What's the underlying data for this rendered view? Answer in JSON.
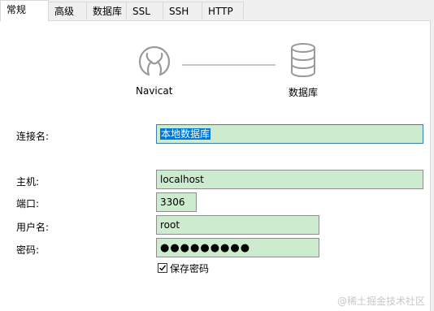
{
  "tabs": [
    {
      "label": "常规",
      "active": true
    },
    {
      "label": "高级"
    },
    {
      "label": "数据库"
    },
    {
      "label": "SSL"
    },
    {
      "label": "SSH"
    },
    {
      "label": "HTTP"
    }
  ],
  "diagram": {
    "left_label": "Navicat",
    "right_label": "数据库",
    "left_icon": "navicat-logo-icon",
    "right_icon": "database-icon"
  },
  "form": {
    "connection_name": {
      "label": "连接名:",
      "value": "本地数据库"
    },
    "host": {
      "label": "主机:",
      "value": "localhost"
    },
    "port": {
      "label": "端口:",
      "value": "3306"
    },
    "username": {
      "label": "用户名:",
      "value": "root"
    },
    "password": {
      "label": "密码:",
      "value": "●●●●●●●●●"
    },
    "save_password": {
      "label": "保存密码",
      "checked": true
    }
  },
  "watermark": "@稀土掘金技术社区",
  "colors": {
    "field_bg": "#cdeccf",
    "selection": "#0078d7"
  }
}
